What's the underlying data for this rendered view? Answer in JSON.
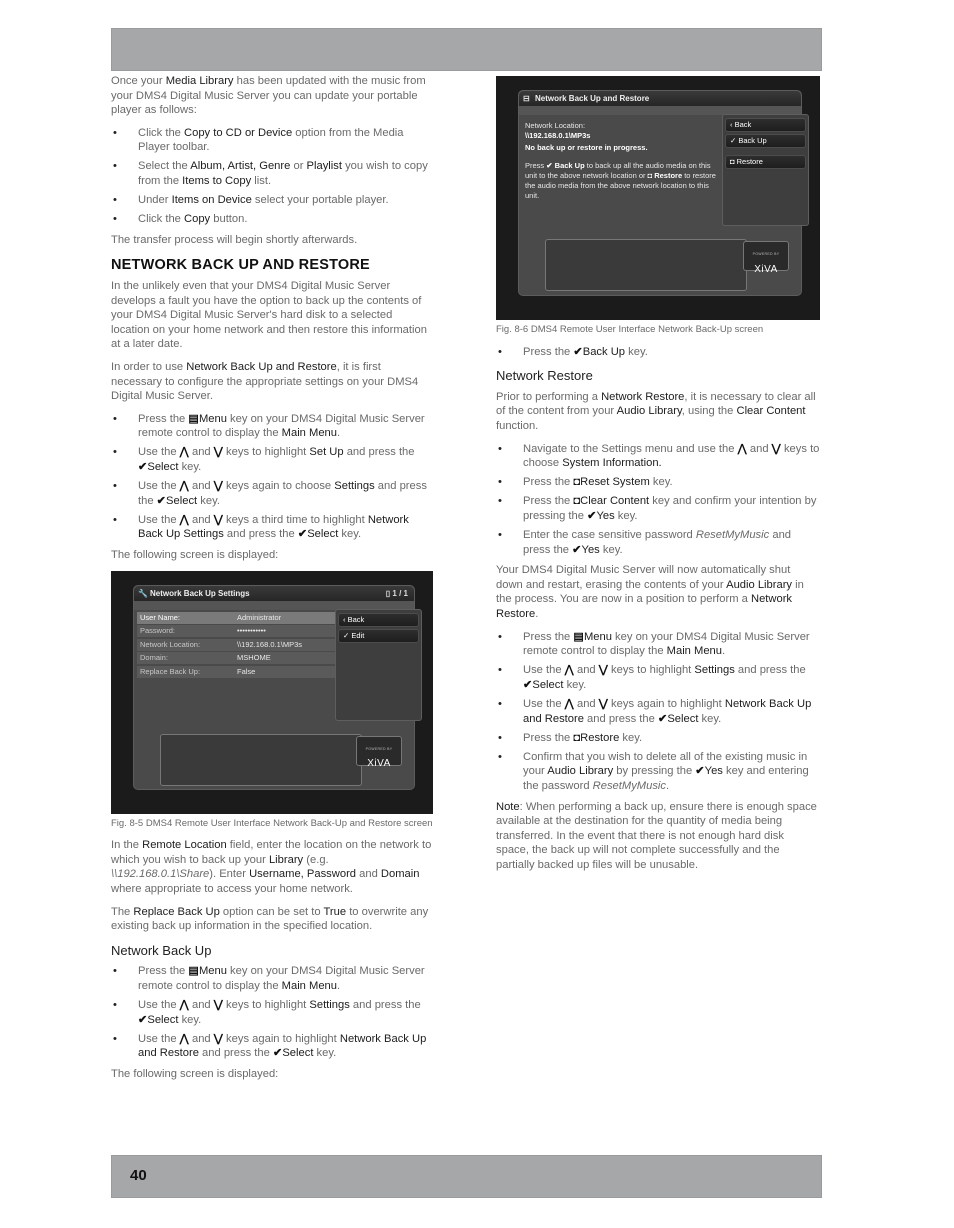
{
  "page_number": "40",
  "left": {
    "intro": {
      "p1": [
        "Once your ",
        "Media Library",
        " has been updated with the music from your DMS4 Digital Music Server you can update your portable player as follows:"
      ],
      "steps": [
        [
          "Click the ",
          "Copy to CD or Device",
          " option from the Media Player toolbar."
        ],
        [
          "Select the ",
          "Album, Artist, Genre",
          " or ",
          "Playlist",
          " you wish to copy from the ",
          "Items to Copy",
          " list."
        ],
        [
          "Under ",
          "Items on Device",
          " select your portable player."
        ],
        [
          "Click the ",
          "Copy",
          " button."
        ]
      ],
      "after": "The transfer process will begin shortly afterwards."
    },
    "section_heading": "NETWORK BACK UP AND RESTORE",
    "section_p1": "In the unlikely even that your DMS4 Digital Music Server develops a fault you have the option to back up the contents of your DMS4 Digital Music Server's hard disk to a selected location on your home network and then restore this information at a later date.",
    "section_p2": [
      "In order to use ",
      "Network Back Up and Restore",
      ", it is first necessary to configure the appropriate settings on your DMS4 Digital Music Server."
    ],
    "setup_steps": {
      "s1": [
        "Press the ",
        "Menu",
        " key on your DMS4 Digital Music Server remote control to display the ",
        "Main Menu",
        "."
      ],
      "s2": [
        "Use the ",
        " and ",
        " keys to highlight ",
        "Set Up",
        " and press the ",
        "Select",
        " key."
      ],
      "s3": [
        "Use the ",
        " and ",
        " keys again to choose ",
        "Settings",
        " and press the ",
        "Select",
        " key."
      ],
      "s4": [
        "Use the ",
        " and ",
        " keys a third time to highlight ",
        "Network Back Up Settings",
        " and press the ",
        "Select",
        " key."
      ]
    },
    "following": "The following screen is displayed:",
    "figure1": {
      "title": "Network Back Up Settings",
      "page_indicator": "1 / 1",
      "rows": [
        {
          "label": "User Name:",
          "value": "Administrator"
        },
        {
          "label": "Password:",
          "value": "•••••••••••"
        },
        {
          "label": "Network Location:",
          "value": "\\\\192.168.0.1\\MP3s"
        },
        {
          "label": "Domain:",
          "value": "MSHOME"
        },
        {
          "label": "Replace Back Up:",
          "value": "False"
        }
      ],
      "buttons": {
        "back": "Back",
        "edit": "Edit"
      },
      "logo_powered": "POWERED BY",
      "logo": "XiVA",
      "caption": "Fig. 8-5  DMS4 Remote User Interface Network Back-Up and Restore screen"
    },
    "remote_p": [
      "In the ",
      "Remote Location",
      " field, enter the location on the network to which you wish to back up your ",
      "Library",
      " (e.g. ",
      "\\\\192.168.0.1\\Share",
      ").  Enter ",
      "Username, Password",
      " and ",
      "Domain",
      " where appropriate to access your home network."
    ],
    "replace_p": [
      "The ",
      "Replace Back Up",
      " option can be set to ",
      "True",
      " to overwrite any existing back up information in the specified location."
    ],
    "backup_heading": "Network Back Up",
    "backup_steps": {
      "s1": [
        "Press the ",
        "Menu",
        " key on your DMS4 Digital Music Server remote control to display the ",
        "Main Menu",
        "."
      ],
      "s2": [
        "Use the ",
        " and ",
        " keys to highlight ",
        "Settings",
        " and press the ",
        "Select",
        " key."
      ],
      "s3": [
        "Use the ",
        " and ",
        " keys again to highlight ",
        "Network Back Up and Restore",
        " and press the ",
        "Select",
        " key."
      ]
    },
    "following2": "The following screen is displayed:"
  },
  "right": {
    "figure2": {
      "title": "Network Back Up and Restore",
      "location_label": "Network Location:",
      "location_value": "\\\\192.168.0.1\\MP3s",
      "status": "No back up or restore in progress.",
      "instructions": [
        "Press ",
        " Back Up",
        " to back up all the audio media on this unit to the above network location or ",
        "Restore",
        " to restore the audio media from the above network location to this unit."
      ],
      "buttons": {
        "back": "Back",
        "backup": "Back Up",
        "restore": "Restore"
      },
      "logo_powered": "POWERED BY",
      "logo": "XiVA",
      "caption": "Fig. 8-6  DMS4 Remote User Interface Network Back-Up screen"
    },
    "press_backup": [
      "Press the ",
      "Back Up",
      " key."
    ],
    "restore_heading": "Network Restore",
    "restore_p": [
      "Prior to performing a ",
      "Network Restore",
      ", it is necessary to clear all of the content from your ",
      "Audio Library",
      ", using the ",
      "Clear Content",
      " function."
    ],
    "restore_steps": {
      "s1": [
        "Navigate to the Settings menu and use the ",
        " and ",
        " keys to choose ",
        "System Information."
      ],
      "s2": [
        "Press the ",
        "Reset System",
        " key."
      ],
      "s3": [
        "Press the ",
        "Clear Content",
        " key and confirm your intention by pressing the ",
        "Yes",
        " key."
      ],
      "s4": [
        "Enter the case sensitive password ",
        "ResetMyMusic",
        " and press the ",
        "Yes",
        " key."
      ]
    },
    "shutdown_p": [
      "Your DMS4 Digital Music Server will now automatically shut down and restart, erasing the contents of your ",
      "Audio Library",
      " in the process.  You are now in a position to perform a ",
      "Network Restore",
      "."
    ],
    "restore2_steps": {
      "s1": [
        "Press the ",
        "Menu",
        " key on your DMS4 Digital Music Server remote control to display the ",
        "Main Menu",
        "."
      ],
      "s2": [
        "Use the ",
        " and ",
        " keys to highlight ",
        "Settings",
        " and press the ",
        "Select",
        " key."
      ],
      "s3": [
        "Use the ",
        " and ",
        " keys again to highlight ",
        "Network Back Up and Restore",
        " and press the ",
        "Select",
        " key."
      ],
      "s4": [
        "Press the ",
        "Restore",
        " key."
      ],
      "s5": [
        "Confirm that you wish to delete all of the existing music in your ",
        "Audio Library",
        " by pressing the ",
        "Yes",
        " key and entering the password ",
        "ResetMyMusic",
        "."
      ]
    },
    "note": [
      "Note",
      ": When performing a back up, ensure there is enough space available at the destination for the quantity of media being transferred.  In the event that there is not enough hard disk space, the back up will not complete successfully and the partially backed up files will be unusable."
    ]
  },
  "icons": {
    "menu": "▤",
    "up": "⋀",
    "down": "⋁",
    "check": "✔",
    "circle": "◘",
    "back_chevron": "<"
  }
}
